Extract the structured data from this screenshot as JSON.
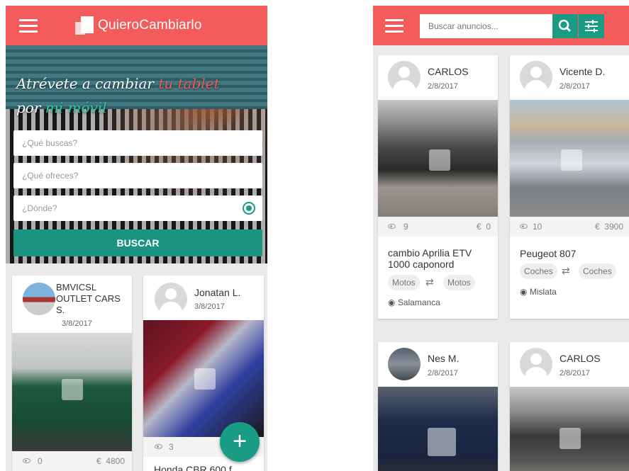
{
  "left_screen": {
    "brand": "QuieroCambiarlo",
    "hero": {
      "tagline_part1": "Atrévete a cambiar",
      "tagline_highlight1": "tu tablet",
      "tagline_part2": "por",
      "tagline_highlight2": "mi móvil"
    },
    "search_form": {
      "what_placeholder": "¿Qué buscas?",
      "offer_placeholder": "¿Qué ofreces?",
      "where_placeholder": "¿Dónde?",
      "submit_label": "BUSCAR"
    },
    "listings": [
      {
        "user": "BMVICSL OUTLET CARS S.",
        "date": "3/8/2017",
        "views": "0",
        "price_currency": "€",
        "price": "4800"
      },
      {
        "user": "Jonatan L.",
        "date": "3/8/2017",
        "views": "3",
        "title": "Honda CBR 600 f"
      }
    ],
    "fab_label": "+"
  },
  "right_screen": {
    "search": {
      "placeholder": "Buscar anuncios..."
    },
    "listings": [
      {
        "user": "CARLOS",
        "date": "2/8/2017",
        "views": "9",
        "price_currency": "€",
        "price": "0",
        "title": "cambio Aprilia ETV 1000 caponord",
        "offer_category": "Motos",
        "want_category": "Motos",
        "location": "Salamanca"
      },
      {
        "user": "Vicente D.",
        "date": "2/8/2017",
        "views": "10",
        "price_currency": "€",
        "price": "3900",
        "title": "Peugeot 807",
        "offer_category": "Coches",
        "want_category": "Coches",
        "location": "Mislata"
      },
      {
        "user": "Nes M.",
        "date": "2/8/2017"
      },
      {
        "user": "CARLOS",
        "date": "2/8/2017"
      }
    ]
  },
  "colors": {
    "primary_red": "#f45b5b",
    "teal": "#1a9c84",
    "background": "#eaeaea"
  }
}
